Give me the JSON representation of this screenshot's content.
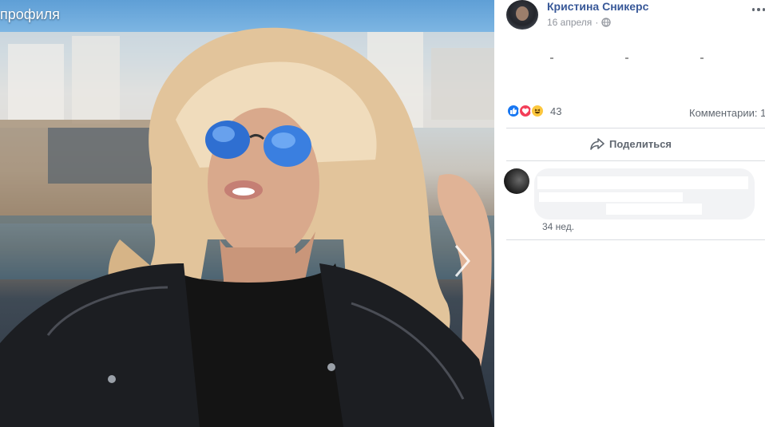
{
  "photo": {
    "caption": "профиля"
  },
  "post": {
    "author": "Кристина Сникерс",
    "date": "16 апреля",
    "date_separator": "·",
    "reaction_count": "43",
    "comments_label": "Комментарии: 1",
    "share_label": "Поделиться"
  },
  "comment": {
    "time": "34 нед."
  },
  "colors": {
    "link_blue": "#385898",
    "like_blue": "#1877f2",
    "love_red": "#f33e58",
    "haha_yellow": "#fcc73e",
    "panel_bg": "#ffffff",
    "bubble_bg": "#f2f3f5"
  },
  "icons": {
    "globe": "globe-icon",
    "share": "share-icon",
    "next": "chevron-right-icon",
    "more": "more-icon"
  }
}
